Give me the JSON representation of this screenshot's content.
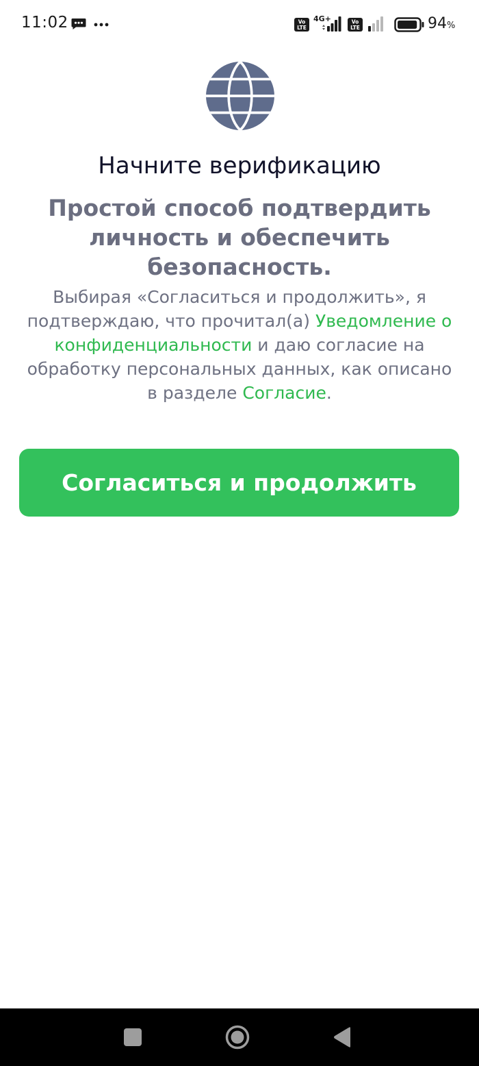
{
  "status_bar": {
    "time": "11:02",
    "network_label": "4G+",
    "battery_level": "94",
    "battery_unit": "%",
    "battery_fraction": 0.94
  },
  "main": {
    "title": "Начните верификацию",
    "subtitle": "Простой способ подтвердить личность и обеспечить безопасность.",
    "consent_prefix": "Выбирая «Согласиться и продолжить», я подтверждаю, что прочитал(а) ",
    "privacy_link": "Уведомление о конфиденциальности",
    "consent_middle": " и даю согласие на обработку персональных данных, как описано в разделе ",
    "consent_link": "Согласие",
    "consent_suffix": "."
  },
  "actions": {
    "continue_label": "Согласиться и продолжить"
  },
  "icons": {
    "header": "globe-icon",
    "status": [
      "message-icon",
      "more-icon",
      "volte-icon",
      "signal-icon",
      "battery-icon"
    ],
    "nav": [
      "recents-icon",
      "home-icon",
      "back-icon"
    ]
  },
  "colors": {
    "accent": "#33c15c",
    "link": "#2fb94f",
    "globe": "#5f6c8c",
    "title": "#12132a",
    "muted_text": "#6b6e80"
  }
}
